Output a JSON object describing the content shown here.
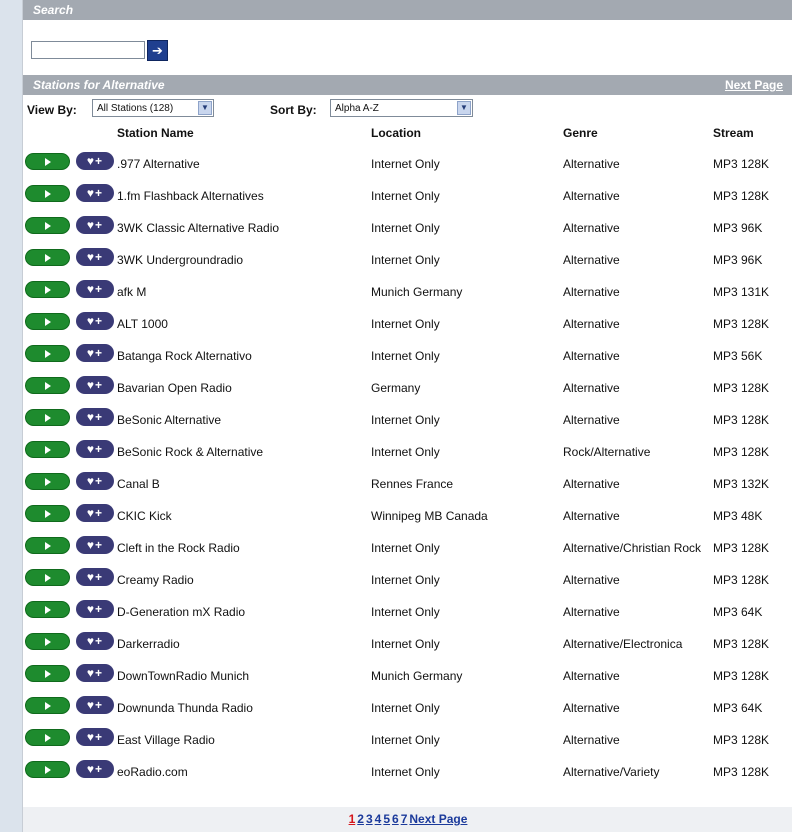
{
  "search": {
    "header": "Search",
    "value": "",
    "go_glyph": "➔"
  },
  "stations_header": {
    "title": "Stations for Alternative",
    "next_page": "Next Page"
  },
  "controls": {
    "view_by_label": "View By:",
    "view_by_value": "All Stations (128)",
    "sort_by_label": "Sort By:",
    "sort_by_value": "Alpha A-Z"
  },
  "columns": {
    "name": "Station Name",
    "location": "Location",
    "genre": "Genre",
    "stream": "Stream"
  },
  "fav_glyph": "♥+",
  "rows": [
    {
      "name": ".977 Alternative",
      "location": "Internet Only",
      "genre": "Alternative",
      "stream": "MP3 128K"
    },
    {
      "name": "1.fm Flashback Alternatives",
      "location": "Internet Only",
      "genre": "Alternative",
      "stream": "MP3 128K"
    },
    {
      "name": "3WK Classic Alternative Radio",
      "location": "Internet Only",
      "genre": "Alternative",
      "stream": "MP3 96K"
    },
    {
      "name": "3WK Undergroundradio",
      "location": "Internet Only",
      "genre": "Alternative",
      "stream": "MP3 96K"
    },
    {
      "name": "afk M",
      "location": "Munich Germany",
      "genre": "Alternative",
      "stream": "MP3 131K"
    },
    {
      "name": "ALT 1000",
      "location": "Internet Only",
      "genre": "Alternative",
      "stream": "MP3 128K"
    },
    {
      "name": "Batanga Rock Alternativo",
      "location": "Internet Only",
      "genre": "Alternative",
      "stream": "MP3 56K"
    },
    {
      "name": "Bavarian Open Radio",
      "location": "Germany",
      "genre": "Alternative",
      "stream": "MP3 128K"
    },
    {
      "name": "BeSonic Alternative",
      "location": "Internet Only",
      "genre": "Alternative",
      "stream": "MP3 128K"
    },
    {
      "name": "BeSonic Rock & Alternative",
      "location": "Internet Only",
      "genre": "Rock/Alternative",
      "stream": "MP3 128K"
    },
    {
      "name": "Canal B",
      "location": "Rennes France",
      "genre": "Alternative",
      "stream": "MP3 132K"
    },
    {
      "name": "CKIC Kick",
      "location": "Winnipeg MB Canada",
      "genre": "Alternative",
      "stream": "MP3 48K"
    },
    {
      "name": "Cleft in the Rock Radio",
      "location": "Internet Only",
      "genre": "Alternative/Christian Rock",
      "stream": "MP3 128K"
    },
    {
      "name": "Creamy Radio",
      "location": "Internet Only",
      "genre": "Alternative",
      "stream": "MP3 128K"
    },
    {
      "name": "D-Generation mX Radio",
      "location": "Internet Only",
      "genre": "Alternative",
      "stream": "MP3 64K"
    },
    {
      "name": "Darkerradio",
      "location": "Internet Only",
      "genre": "Alternative/Electronica",
      "stream": "MP3 128K"
    },
    {
      "name": "DownTownRadio Munich",
      "location": "Munich Germany",
      "genre": "Alternative",
      "stream": "MP3 128K"
    },
    {
      "name": "Downunda Thunda Radio",
      "location": "Internet Only",
      "genre": "Alternative",
      "stream": "MP3 64K"
    },
    {
      "name": "East Village Radio",
      "location": "Internet Only",
      "genre": "Alternative",
      "stream": "MP3 128K"
    },
    {
      "name": "eoRadio.com",
      "location": "Internet Only",
      "genre": "Alternative/Variety",
      "stream": "MP3 128K"
    }
  ],
  "pager": {
    "pages": [
      "1",
      "2",
      "3",
      "4",
      "5",
      "6",
      "7"
    ],
    "current": "1",
    "next": "Next Page"
  },
  "colors": {
    "band": "#a3a9b1",
    "play": "#1e8b2e",
    "fav": "#3a3a76",
    "current_page": "#d4151b",
    "link": "#1b3a9b"
  }
}
